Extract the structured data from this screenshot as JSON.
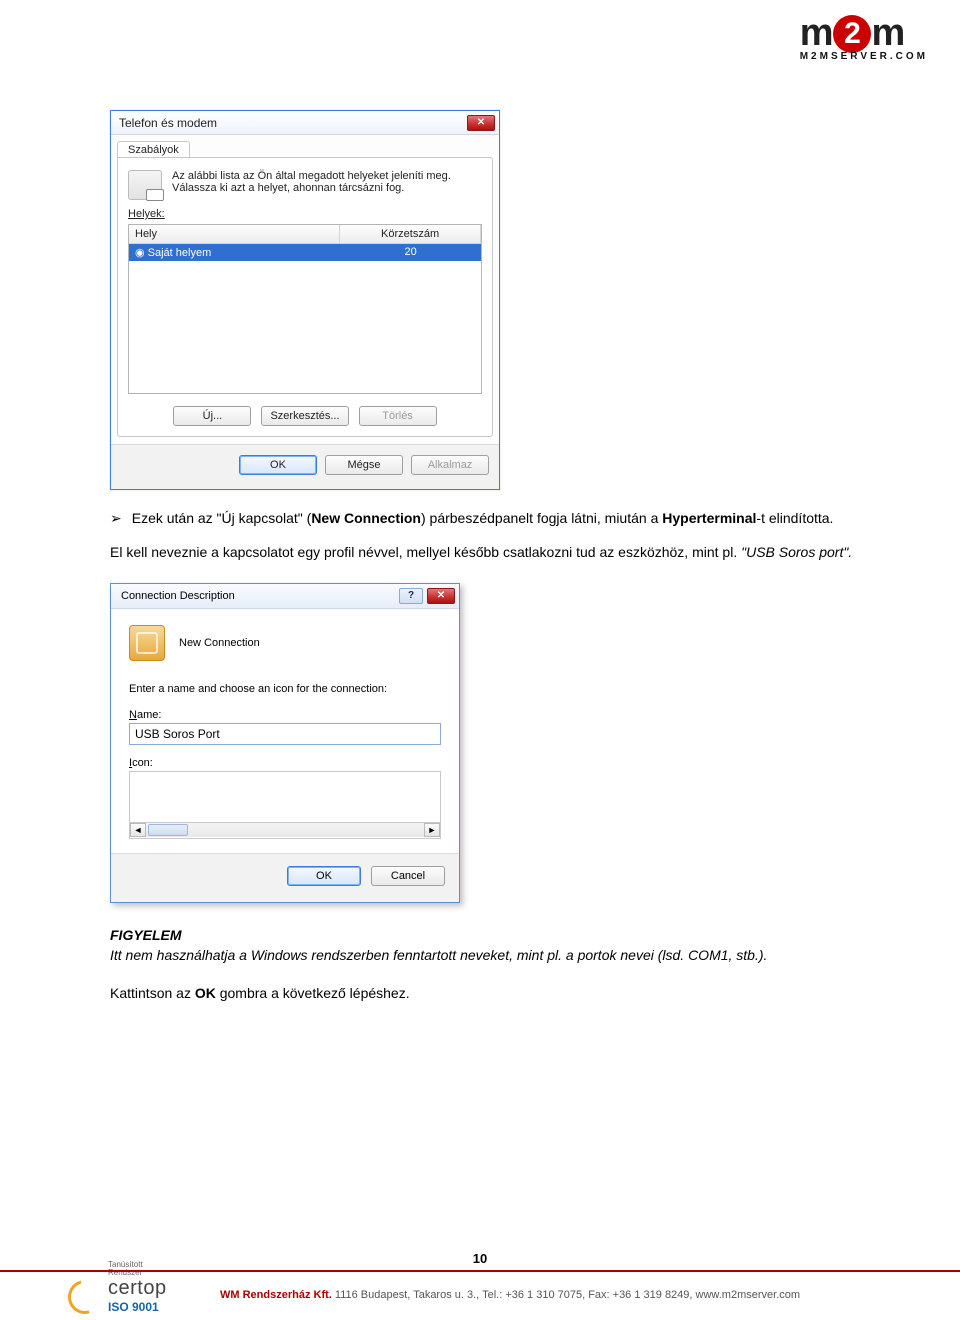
{
  "logo": {
    "sub": "M2MSERVER.COM"
  },
  "dlg1": {
    "title": "Telefon és modem",
    "tab": "Szabályok",
    "desc": "Az alábbi lista az Ön által megadott helyeket jeleníti meg. Válassza ki azt a helyet, ahonnan tárcsázni fog.",
    "list_label": "Helyek:",
    "col1": "Hely",
    "col2": "Körzetszám",
    "row_place": "Saját helyem",
    "row_code": "20",
    "btn_new": "Új...",
    "btn_edit": "Szerkesztés...",
    "btn_del": "Törlés",
    "ok": "OK",
    "cancel": "Mégse",
    "apply": "Alkalmaz"
  },
  "para1": {
    "lead": "Ezek után az \"Új kapcsolat\" (",
    "bold1": "New Connection",
    "mid": ") párbeszédpanelt fogja látni, miután a ",
    "bold2": "Hyperterminal",
    "tail": "-t elindította."
  },
  "para2": {
    "line1": "El kell neveznie a kapcsolatot egy profil névvel, mellyel később csatlakozni tud az eszközhöz, mint pl.",
    "line2": "\"USB Soros port\"."
  },
  "dlg2": {
    "title": "Connection Description",
    "heading": "New Connection",
    "prompt": "Enter a name and choose an icon for the connection:",
    "name_label": "Name:",
    "name_value": "USB Soros Port",
    "icon_label": "Icon:",
    "ok": "OK",
    "cancel": "Cancel"
  },
  "attn": {
    "title": "FIGYELEM",
    "body": "Itt nem használhatja a Windows rendszerben fenntartott neveket, mint pl. a portok nevei (lsd. COM1, stb.)."
  },
  "closing": {
    "pre": "Kattintson az ",
    "bold": "OK",
    "post": " gombra a következő lépéshez."
  },
  "page_number": "10",
  "footer": "WM Rendszerház Kft. 1116 Budapest, Takaros u. 3., Tel.: +36 1 310 7075, Fax: +36 1 319 8249, www.m2mserver.com",
  "cert": {
    "small1": "Tanúsított",
    "small2": "Rendszer",
    "name": "certop",
    "iso": "ISO 9001"
  }
}
